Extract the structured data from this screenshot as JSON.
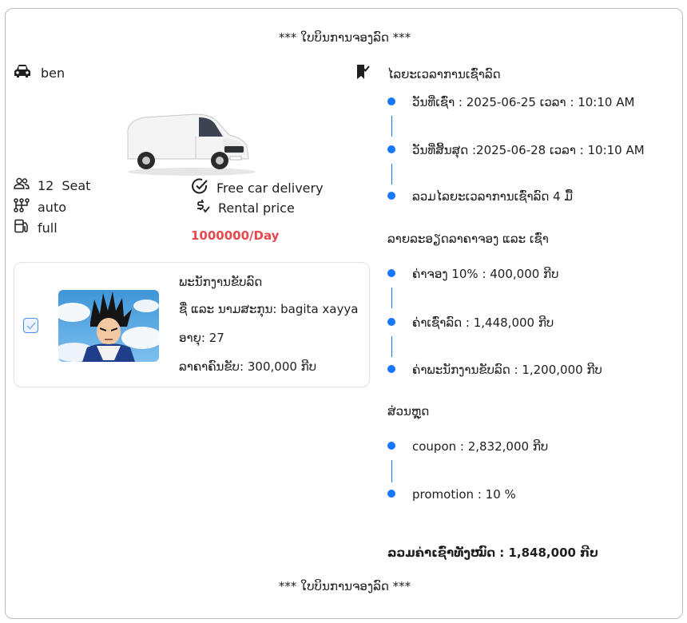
{
  "receipt": {
    "banner_top": "*** ໃບບິນການຈອງລົດ ***",
    "banner_bottom": "*** ໃບບິນການຈອງລົດ ***"
  },
  "car": {
    "name": "ben",
    "seats_number": "12",
    "seats_label": "Seat",
    "transmission": "auto",
    "fuel": "full",
    "delivery": "Free car delivery",
    "rental_price_label": "Rental price",
    "price_per_day": "1000000/Day"
  },
  "staff": {
    "title": "ພະນັກງານຂັບລົດ",
    "name_line": "ຊື່ ແລະ ນາມສະກຸນ: bagita xayya",
    "age_line": "ອາຍຸ: 27",
    "price_line": "ລາຄາຄົນຂັບ: 300,000 ກີບ",
    "checked": true
  },
  "rental_period": {
    "title": "ໄລຍະເວລາການເຊົ່າລົດ",
    "items": [
      "ວັນທີ່ເຊົ່າ : 2025-06-25 ເວລາ : 10:10 AM",
      "ວັນທີ່ສິ້ນສຸດ :2025-06-28 ເວລາ : 10:10 AM",
      "ລວມໄລຍະເວລາການເຊົ່າລົດ 4 ມື້"
    ]
  },
  "price_details": {
    "title": "ລາຍລະອຽດລາຄາຈອງ ແລະ ເຊົ່າ",
    "items": [
      "ຄ່າຈອງ 10% : 400,000 ກີບ",
      "ຄ່າເຊົ່າລົດ : 1,448,000 ກີບ",
      "ຄ່າພະນັກງານຂັບລົດ : 1,200,000 ກີບ"
    ]
  },
  "discount": {
    "title": "ສ່ວນຫຼຸດ",
    "items": [
      "coupon : 2,832,000 ກີບ",
      "promotion : 10 %"
    ]
  },
  "total": "ລວມຄ່າເຊົ່າທັງໝົດ : 1,848,000 ກີບ",
  "colors": {
    "accent": "#1677ff",
    "price": "#e5484d",
    "border": "#bdbdbd"
  }
}
